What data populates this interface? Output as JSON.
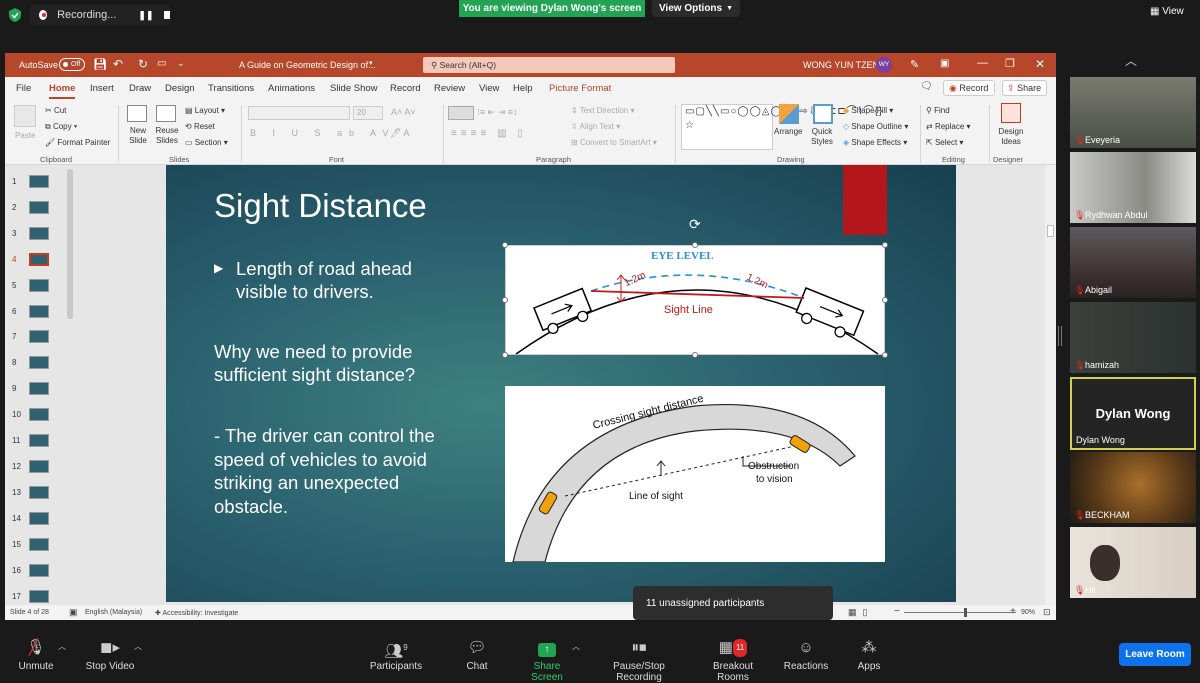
{
  "zoom_top": {
    "recording_label": "Recording...",
    "viewing_banner": "You are viewing Dylan Wong's screen",
    "view_options": "View Options",
    "view_button": "View"
  },
  "powerpoint": {
    "autosave": "AutoSave",
    "autosave_state": "Off",
    "doc_title": "A Guide on Geometric Design of...",
    "search_placeholder": "Search (Alt+Q)",
    "context_tab": "Picture Format",
    "user_name": "WONG YUN TZEN",
    "user_initials": "WY",
    "menu": [
      "File",
      "Home",
      "Insert",
      "Draw",
      "Design",
      "Transitions",
      "Animations",
      "Slide Show",
      "Record",
      "Review",
      "View",
      "Help"
    ],
    "record_btn": "Record",
    "share_btn": "Share",
    "ribbon": {
      "paste": "Paste",
      "cut": "Cut",
      "copy": "Copy",
      "format_painter": "Format Painter",
      "clipboard": "Clipboard",
      "new_slide": "New Slide",
      "reuse_slides": "Reuse Slides",
      "layout": "Layout",
      "reset": "Reset",
      "section": "Section",
      "slides": "Slides",
      "font_size": "20",
      "font": "Font",
      "text_direction": "Text Direction",
      "align_text": "Align Text",
      "convert_smartart": "Convert to SmartArt",
      "paragraph": "Paragraph",
      "arrange": "Arrange",
      "quick_styles": "Quick Styles",
      "shape_fill": "Shape Fill",
      "shape_outline": "Shape Outline",
      "shape_effects": "Shape Effects",
      "drawing": "Drawing",
      "find": "Find",
      "replace": "Replace",
      "select": "Select",
      "editing": "Editing",
      "design_ideas": "Design Ideas",
      "designer": "Designer"
    },
    "thumbnail_numbers": [
      "1",
      "2",
      "3",
      "4",
      "5",
      "6",
      "7",
      "8",
      "9",
      "10",
      "11",
      "12",
      "13",
      "14",
      "15",
      "16",
      "17"
    ],
    "status": {
      "slide_of": "Slide 4 of 28",
      "language": "English (Malaysia)",
      "accessibility": "Accessibility: Investigate",
      "zoom": "90%"
    }
  },
  "slide": {
    "title": "Sight Distance",
    "bullet1": "Length of road ahead visible to drivers.",
    "question": "Why we need to provide sufficient sight distance?",
    "answer": "- The driver can control the speed of vehicles to avoid striking an unexpected obstacle.",
    "fig1": {
      "eye_level": "EYE LEVEL",
      "h1": "1.2m",
      "h2": "1.2m",
      "sight_line": "Sight Line"
    },
    "fig2": {
      "crossing": "Crossing sight distance",
      "obstruction1": "Obstruction",
      "obstruction2": "to vision",
      "line_of_sight": "Line of sight"
    }
  },
  "participants_panel": [
    {
      "name": "Eveyeria",
      "muted": true
    },
    {
      "name": "Rydhwan Abdul",
      "muted": true
    },
    {
      "name": "Abigail",
      "muted": true
    },
    {
      "name": "hamizah",
      "muted": true
    },
    {
      "name": "Dylan Wong",
      "muted": false,
      "center_name": "Dylan Wong",
      "active": true
    },
    {
      "name": "BECKHAM",
      "muted": true
    },
    {
      "name": "Hii",
      "muted": true
    }
  ],
  "popover": "11 unassigned participants",
  "toolbar": {
    "unmute": "Unmute",
    "stop_video": "Stop Video",
    "participants": "Participants",
    "participants_count": "9",
    "chat": "Chat",
    "share_screen": "Share Screen",
    "pause_stop": "Pause/Stop Recording",
    "breakout": "Breakout Rooms",
    "breakout_badge": "11",
    "reactions": "Reactions",
    "apps": "Apps",
    "leave": "Leave Room"
  },
  "colors": {
    "ppt_accent": "#b7472a",
    "zoom_green": "#23a454",
    "leave_blue": "#0e72ed"
  }
}
